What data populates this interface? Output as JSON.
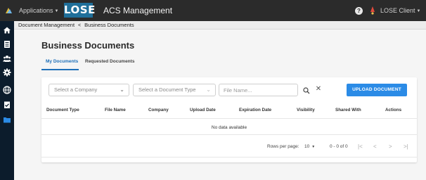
{
  "header": {
    "apps_label": "Applications",
    "logo_text": "LOSE",
    "title": "ACS Management",
    "help_label": "?",
    "user_label": "LOSE Client"
  },
  "sidebar": {
    "icons": [
      "home-icon",
      "list-icon",
      "users-icon",
      "gear-icon",
      "globe-icon",
      "clipboard-check-icon",
      "folder-icon"
    ],
    "active": "folder-icon"
  },
  "breadcrumb": {
    "root": "Document Management",
    "separator": "<",
    "current": "Business Documents"
  },
  "page": {
    "title": "Business Documents"
  },
  "tabs": [
    {
      "label": "My Documents",
      "active": true
    },
    {
      "label": "Requested Documents",
      "active": false
    }
  ],
  "filters": {
    "company_placeholder": "Select a Company",
    "doctype_placeholder": "Select a Document Type",
    "filename_placeholder": "File Name...",
    "upload_label": "UPLOAD DOCUMENT"
  },
  "table": {
    "columns": [
      "Document Type",
      "File Name",
      "Company",
      "Upload Date",
      "Expiration Date",
      "Visibility",
      "Shared With",
      "Actions"
    ],
    "rows": [],
    "empty_text": "No data available"
  },
  "pagination": {
    "rows_per_page_label": "Rows per page:",
    "rows_per_page_value": "10",
    "range_text": "0 - 0 of 0",
    "first": "|<",
    "prev": "<",
    "next": ">",
    "last": ">|"
  },
  "colors": {
    "topbar": "#2b2b2b",
    "sidebar": "#0c1c2c",
    "logo_bg": "#1f6f9a",
    "accent": "#1e6fb8",
    "upload_button": "#2b8be6",
    "active_sidebar_icon": "#2b8be6"
  }
}
